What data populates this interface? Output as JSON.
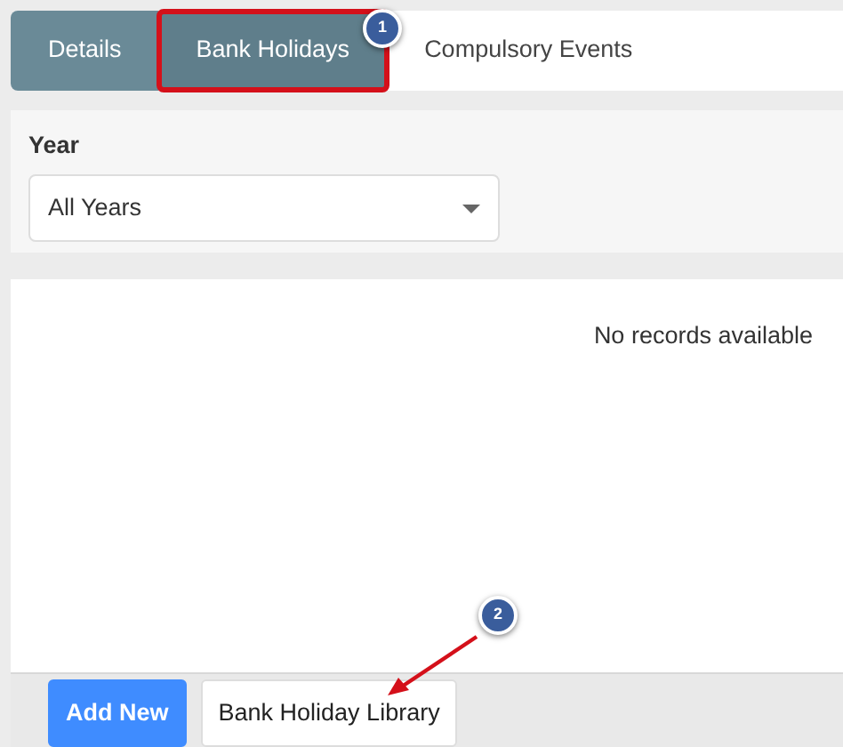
{
  "tabs": [
    {
      "label": "Details",
      "selected": false,
      "highlighted": false
    },
    {
      "label": "Bank Holidays",
      "selected": true,
      "highlighted": true
    },
    {
      "label": "Compulsory Events",
      "selected": false,
      "highlighted": false
    }
  ],
  "filter": {
    "label": "Year",
    "value": "All Years"
  },
  "grid": {
    "empty_message": "No records available"
  },
  "buttons": [
    {
      "label": "Add New",
      "kind": "primary"
    },
    {
      "label": "Bank Holiday Library",
      "kind": "secondary"
    }
  ],
  "annotations": [
    {
      "label": "1",
      "arrow": false
    },
    {
      "label": "2",
      "arrow": true
    }
  ]
}
